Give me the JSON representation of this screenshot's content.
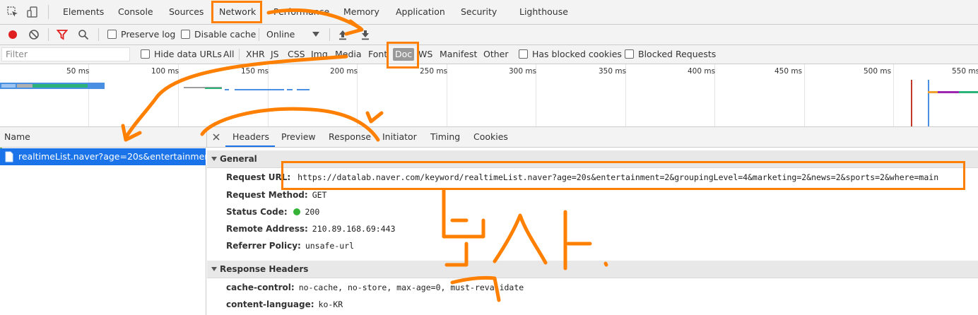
{
  "tabs": [
    "Elements",
    "Console",
    "Sources",
    "Network",
    "Performance",
    "Memory",
    "Application",
    "Security",
    "Lighthouse"
  ],
  "toolbar": {
    "preserve_log": "Preserve log",
    "disable_cache": "Disable cache",
    "throttling": "Online"
  },
  "filterbar": {
    "placeholder": "Filter",
    "hide_data_urls": "Hide data URLs",
    "types": [
      "All",
      "XHR",
      "JS",
      "CSS",
      "Img",
      "Media",
      "Font",
      "Doc",
      "WS",
      "Manifest",
      "Other"
    ],
    "selected_type": "Doc",
    "has_blocked_cookies": "Has blocked cookies",
    "blocked_requests": "Blocked Requests"
  },
  "timeline": {
    "ticks": [
      "50 ms",
      "100 ms",
      "150 ms",
      "200 ms",
      "250 ms",
      "300 ms",
      "350 ms",
      "400 ms",
      "450 ms",
      "500 ms",
      "550 ms"
    ]
  },
  "requests": {
    "column_name": "Name",
    "items": [
      "realtimeList.naver?age=20s&entertainmen..."
    ]
  },
  "detail": {
    "tabs": [
      "Headers",
      "Preview",
      "Response",
      "Initiator",
      "Timing",
      "Cookies"
    ],
    "active_tab": "Headers",
    "general": {
      "title": "General",
      "request_url_key": "Request URL:",
      "request_url": "https://datalab.naver.com/keyword/realtimeList.naver?age=20s&entertainment=2&groupingLevel=4&marketing=2&news=2&sports=2&where=main",
      "request_method_key": "Request Method:",
      "request_method": "GET",
      "status_code_key": "Status Code:",
      "status_code": "200",
      "remote_address_key": "Remote Address:",
      "remote_address": "210.89.168.69:443",
      "referrer_policy_key": "Referrer Policy:",
      "referrer_policy": "unsafe-url"
    },
    "response_headers": {
      "title": "Response Headers",
      "cache_control_key": "cache-control:",
      "cache_control": "no-cache, no-store, max-age=0, must-revalidate",
      "content_language_key": "content-language:",
      "content_language": "ko-KR"
    }
  },
  "colors": {
    "annotation": "#ff8000",
    "selected_row": "#1a73e8",
    "record": "#e02020",
    "status_ok": "#36b336"
  }
}
